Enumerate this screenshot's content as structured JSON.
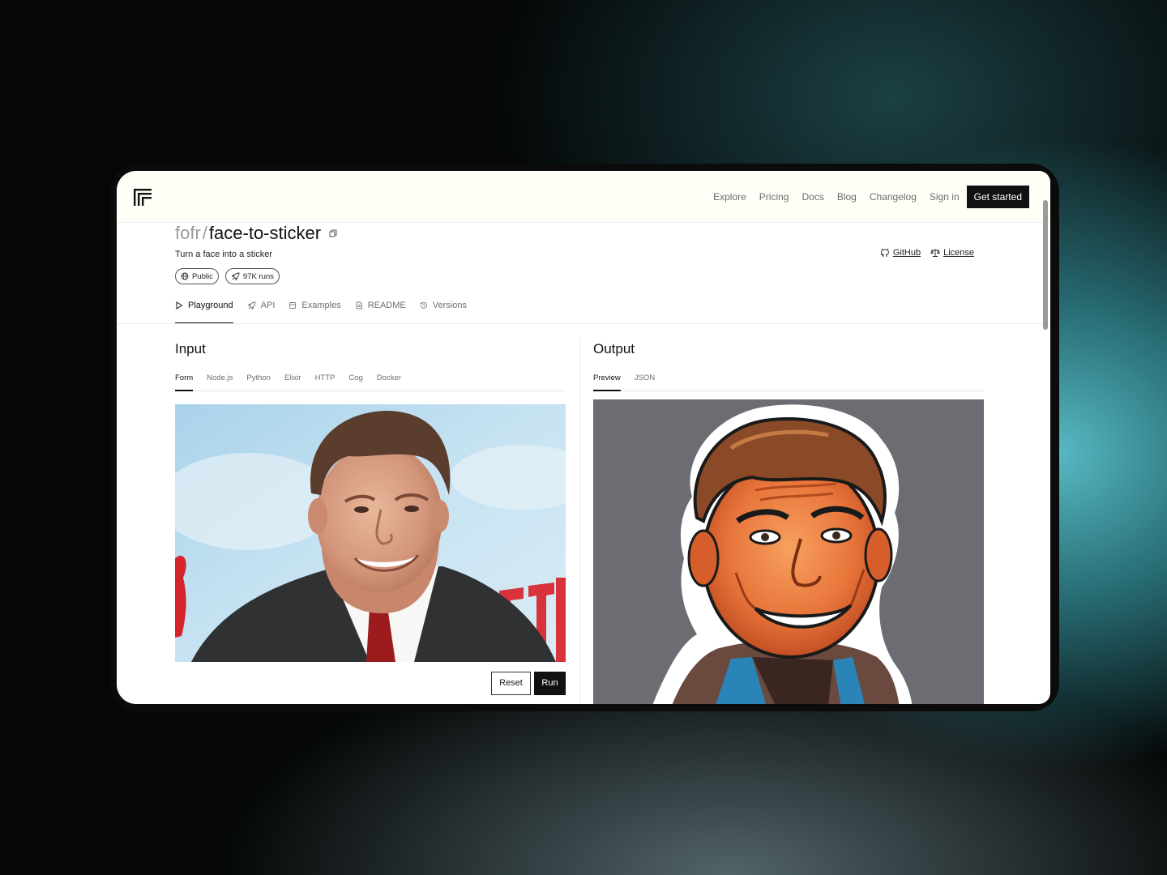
{
  "header": {
    "nav": [
      "Explore",
      "Pricing",
      "Docs",
      "Blog",
      "Changelog",
      "Sign in"
    ],
    "cta": "Get started"
  },
  "repo": {
    "owner": "fofr",
    "separator": "/",
    "name": "face-to-sticker",
    "description": "Turn a face into a sticker",
    "badges": {
      "visibility": "Public",
      "runs": "97K runs"
    },
    "links": {
      "github": "GitHub",
      "license": "License"
    }
  },
  "tabs": [
    "Playground",
    "API",
    "Examples",
    "README",
    "Versions"
  ],
  "input": {
    "title": "Input",
    "subtabs": [
      "Form",
      "Node.js",
      "Python",
      "Elixir",
      "HTTP",
      "Cog",
      "Docker"
    ],
    "reset": "Reset",
    "run": "Run"
  },
  "output": {
    "title": "Output",
    "subtabs": [
      "Preview",
      "JSON"
    ]
  },
  "colors": {
    "accent": "#111111",
    "header_bg": "#fffef7",
    "output_bg": "#6b6d72",
    "sticker_skin": "#e8743a"
  },
  "icons": [
    "replicate-logo-icon",
    "copy-icon",
    "globe-icon",
    "rocket-icon",
    "github-icon",
    "scale-icon",
    "play-icon",
    "history-icon",
    "book-icon",
    "file-icon"
  ]
}
